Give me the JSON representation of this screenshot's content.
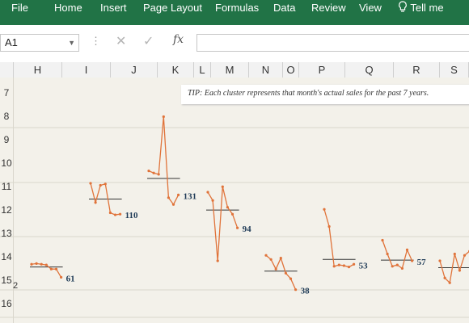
{
  "ribbon": {
    "tabs": [
      "File",
      "Home",
      "Insert",
      "Page Layout",
      "Formulas",
      "Data",
      "Review",
      "View",
      "Tell me"
    ]
  },
  "formula_bar": {
    "name_box": "A1",
    "fx_label": "fx",
    "formula": ""
  },
  "columns": [
    "H",
    "I",
    "J",
    "K",
    "L",
    "M",
    "N",
    "O",
    "P",
    "Q",
    "R",
    "S"
  ],
  "rows": [
    "7",
    "8",
    "9",
    "10",
    "11",
    "12",
    "13",
    "14",
    "15",
    "16"
  ],
  "stray_cell_text": "2",
  "tip": "TIP:  Each cluster represents that month's actual sales for the past 7 years.",
  "colors": {
    "ribbon": "#217346",
    "sparkline": "#e0733a",
    "label": "#1f3b57",
    "sheet": "#f3f1ea"
  },
  "chart_data": {
    "type": "line",
    "description_units": "sales",
    "series": [
      {
        "label": "61",
        "values": [
          55,
          56,
          55,
          54,
          48,
          48,
          36
        ],
        "avg": 51
      },
      {
        "label": "110",
        "values": [
          173,
          145,
          170,
          172,
          130,
          127,
          128
        ],
        "avg": 150
      },
      {
        "label": "131",
        "values": [
          191,
          188,
          186,
          270,
          152,
          142,
          156
        ],
        "avg": 180
      },
      {
        "label": "94",
        "values": [
          160,
          148,
          60,
          168,
          138,
          128,
          108
        ],
        "avg": 134
      },
      {
        "label": "38",
        "values": [
          68,
          62,
          48,
          64,
          42,
          34,
          18
        ],
        "avg": 45
      },
      {
        "label": "53",
        "values": [
          135,
          110,
          52,
          54,
          53,
          51,
          55
        ],
        "avg": 62
      },
      {
        "label": "57",
        "values": [
          90,
          70,
          52,
          54,
          49,
          76,
          60
        ],
        "avg": 61
      },
      {
        "label": "",
        "values": [
          60,
          35,
          28,
          70,
          46,
          68,
          74
        ],
        "avg": 50
      }
    ]
  }
}
